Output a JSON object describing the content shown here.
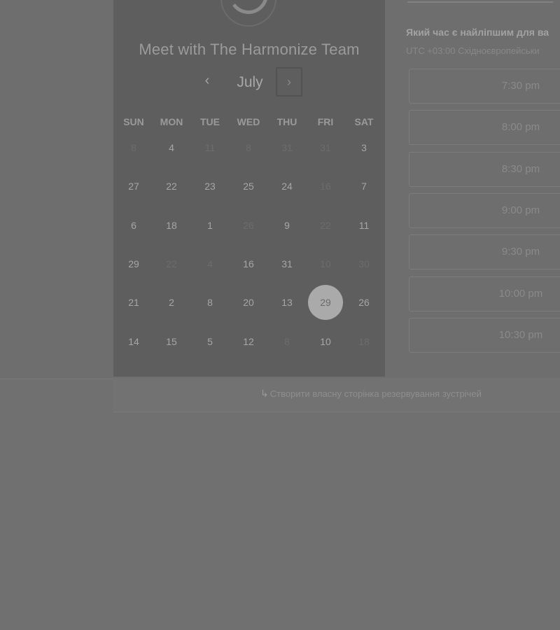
{
  "calendar": {
    "title": "Meet with The Harmonize Team",
    "month": "July",
    "prev_icon": "‹",
    "next_icon": "›",
    "weekdays": [
      "SUN",
      "MON",
      "TUE",
      "WED",
      "THU",
      "FRI",
      "SAT"
    ],
    "weeks": [
      [
        {
          "d": "8",
          "m": true
        },
        {
          "d": "4",
          "m": false
        },
        {
          "d": "11",
          "m": true
        },
        {
          "d": "8",
          "m": true
        },
        {
          "d": "31",
          "m": true
        },
        {
          "d": "31",
          "m": true
        },
        {
          "d": "3",
          "m": false
        }
      ],
      [
        {
          "d": "27",
          "m": false
        },
        {
          "d": "22",
          "m": false
        },
        {
          "d": "23",
          "m": false
        },
        {
          "d": "25",
          "m": false
        },
        {
          "d": "24",
          "m": false
        },
        {
          "d": "16",
          "m": true
        },
        {
          "d": "7",
          "m": false
        }
      ],
      [
        {
          "d": "6",
          "m": false
        },
        {
          "d": "18",
          "m": false
        },
        {
          "d": "1",
          "m": false
        },
        {
          "d": "26",
          "m": true
        },
        {
          "d": "9",
          "m": false
        },
        {
          "d": "22",
          "m": true
        },
        {
          "d": "11",
          "m": false
        }
      ],
      [
        {
          "d": "29",
          "m": false
        },
        {
          "d": "22",
          "m": true
        },
        {
          "d": "4",
          "m": true
        },
        {
          "d": "16",
          "m": false
        },
        {
          "d": "31",
          "m": false
        },
        {
          "d": "10",
          "m": true
        },
        {
          "d": "30",
          "m": true
        }
      ],
      [
        {
          "d": "21",
          "m": false
        },
        {
          "d": "2",
          "m": false
        },
        {
          "d": "8",
          "m": false
        },
        {
          "d": "20",
          "m": false
        },
        {
          "d": "13",
          "m": false
        },
        {
          "d": "29",
          "m": false,
          "selected": true
        },
        {
          "d": "26",
          "m": false
        }
      ],
      [
        {
          "d": "14",
          "m": false
        },
        {
          "d": "15",
          "m": false
        },
        {
          "d": "5",
          "m": false
        },
        {
          "d": "12",
          "m": false
        },
        {
          "d": "8",
          "m": true
        },
        {
          "d": "10",
          "m": false
        },
        {
          "d": "18",
          "m": true
        }
      ]
    ]
  },
  "times": {
    "question": "Який час є найліпшим для ва",
    "timezone": "UTC +03:00 Східноєвропейськи",
    "slots": [
      "7:30 pm",
      "8:00 pm",
      "8:30 pm",
      "9:00 pm",
      "9:30 pm",
      "10:00 pm",
      "10:30 pm"
    ]
  },
  "footer": {
    "icon": "↳",
    "link_text": "Створити власну сторінка резервування зустрічей"
  }
}
